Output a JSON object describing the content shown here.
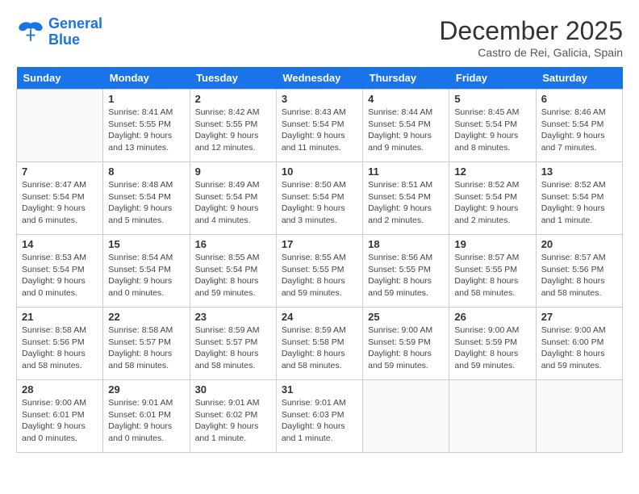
{
  "header": {
    "logo_line1": "General",
    "logo_line2": "Blue",
    "month_title": "December 2025",
    "location": "Castro de Rei, Galicia, Spain"
  },
  "weekdays": [
    "Sunday",
    "Monday",
    "Tuesday",
    "Wednesday",
    "Thursday",
    "Friday",
    "Saturday"
  ],
  "weeks": [
    [
      {
        "date": "",
        "info": ""
      },
      {
        "date": "1",
        "info": "Sunrise: 8:41 AM\nSunset: 5:55 PM\nDaylight: 9 hours\nand 13 minutes."
      },
      {
        "date": "2",
        "info": "Sunrise: 8:42 AM\nSunset: 5:55 PM\nDaylight: 9 hours\nand 12 minutes."
      },
      {
        "date": "3",
        "info": "Sunrise: 8:43 AM\nSunset: 5:54 PM\nDaylight: 9 hours\nand 11 minutes."
      },
      {
        "date": "4",
        "info": "Sunrise: 8:44 AM\nSunset: 5:54 PM\nDaylight: 9 hours\nand 9 minutes."
      },
      {
        "date": "5",
        "info": "Sunrise: 8:45 AM\nSunset: 5:54 PM\nDaylight: 9 hours\nand 8 minutes."
      },
      {
        "date": "6",
        "info": "Sunrise: 8:46 AM\nSunset: 5:54 PM\nDaylight: 9 hours\nand 7 minutes."
      }
    ],
    [
      {
        "date": "7",
        "info": "Sunrise: 8:47 AM\nSunset: 5:54 PM\nDaylight: 9 hours\nand 6 minutes."
      },
      {
        "date": "8",
        "info": "Sunrise: 8:48 AM\nSunset: 5:54 PM\nDaylight: 9 hours\nand 5 minutes."
      },
      {
        "date": "9",
        "info": "Sunrise: 8:49 AM\nSunset: 5:54 PM\nDaylight: 9 hours\nand 4 minutes."
      },
      {
        "date": "10",
        "info": "Sunrise: 8:50 AM\nSunset: 5:54 PM\nDaylight: 9 hours\nand 3 minutes."
      },
      {
        "date": "11",
        "info": "Sunrise: 8:51 AM\nSunset: 5:54 PM\nDaylight: 9 hours\nand 2 minutes."
      },
      {
        "date": "12",
        "info": "Sunrise: 8:52 AM\nSunset: 5:54 PM\nDaylight: 9 hours\nand 2 minutes."
      },
      {
        "date": "13",
        "info": "Sunrise: 8:52 AM\nSunset: 5:54 PM\nDaylight: 9 hours\nand 1 minute."
      }
    ],
    [
      {
        "date": "14",
        "info": "Sunrise: 8:53 AM\nSunset: 5:54 PM\nDaylight: 9 hours\nand 0 minutes."
      },
      {
        "date": "15",
        "info": "Sunrise: 8:54 AM\nSunset: 5:54 PM\nDaylight: 9 hours\nand 0 minutes."
      },
      {
        "date": "16",
        "info": "Sunrise: 8:55 AM\nSunset: 5:54 PM\nDaylight: 8 hours\nand 59 minutes."
      },
      {
        "date": "17",
        "info": "Sunrise: 8:55 AM\nSunset: 5:55 PM\nDaylight: 8 hours\nand 59 minutes."
      },
      {
        "date": "18",
        "info": "Sunrise: 8:56 AM\nSunset: 5:55 PM\nDaylight: 8 hours\nand 59 minutes."
      },
      {
        "date": "19",
        "info": "Sunrise: 8:57 AM\nSunset: 5:55 PM\nDaylight: 8 hours\nand 58 minutes."
      },
      {
        "date": "20",
        "info": "Sunrise: 8:57 AM\nSunset: 5:56 PM\nDaylight: 8 hours\nand 58 minutes."
      }
    ],
    [
      {
        "date": "21",
        "info": "Sunrise: 8:58 AM\nSunset: 5:56 PM\nDaylight: 8 hours\nand 58 minutes."
      },
      {
        "date": "22",
        "info": "Sunrise: 8:58 AM\nSunset: 5:57 PM\nDaylight: 8 hours\nand 58 minutes."
      },
      {
        "date": "23",
        "info": "Sunrise: 8:59 AM\nSunset: 5:57 PM\nDaylight: 8 hours\nand 58 minutes."
      },
      {
        "date": "24",
        "info": "Sunrise: 8:59 AM\nSunset: 5:58 PM\nDaylight: 8 hours\nand 58 minutes."
      },
      {
        "date": "25",
        "info": "Sunrise: 9:00 AM\nSunset: 5:59 PM\nDaylight: 8 hours\nand 59 minutes."
      },
      {
        "date": "26",
        "info": "Sunrise: 9:00 AM\nSunset: 5:59 PM\nDaylight: 8 hours\nand 59 minutes."
      },
      {
        "date": "27",
        "info": "Sunrise: 9:00 AM\nSunset: 6:00 PM\nDaylight: 8 hours\nand 59 minutes."
      }
    ],
    [
      {
        "date": "28",
        "info": "Sunrise: 9:00 AM\nSunset: 6:01 PM\nDaylight: 9 hours\nand 0 minutes."
      },
      {
        "date": "29",
        "info": "Sunrise: 9:01 AM\nSunset: 6:01 PM\nDaylight: 9 hours\nand 0 minutes."
      },
      {
        "date": "30",
        "info": "Sunrise: 9:01 AM\nSunset: 6:02 PM\nDaylight: 9 hours\nand 1 minute."
      },
      {
        "date": "31",
        "info": "Sunrise: 9:01 AM\nSunset: 6:03 PM\nDaylight: 9 hours\nand 1 minute."
      },
      {
        "date": "",
        "info": ""
      },
      {
        "date": "",
        "info": ""
      },
      {
        "date": "",
        "info": ""
      }
    ]
  ]
}
